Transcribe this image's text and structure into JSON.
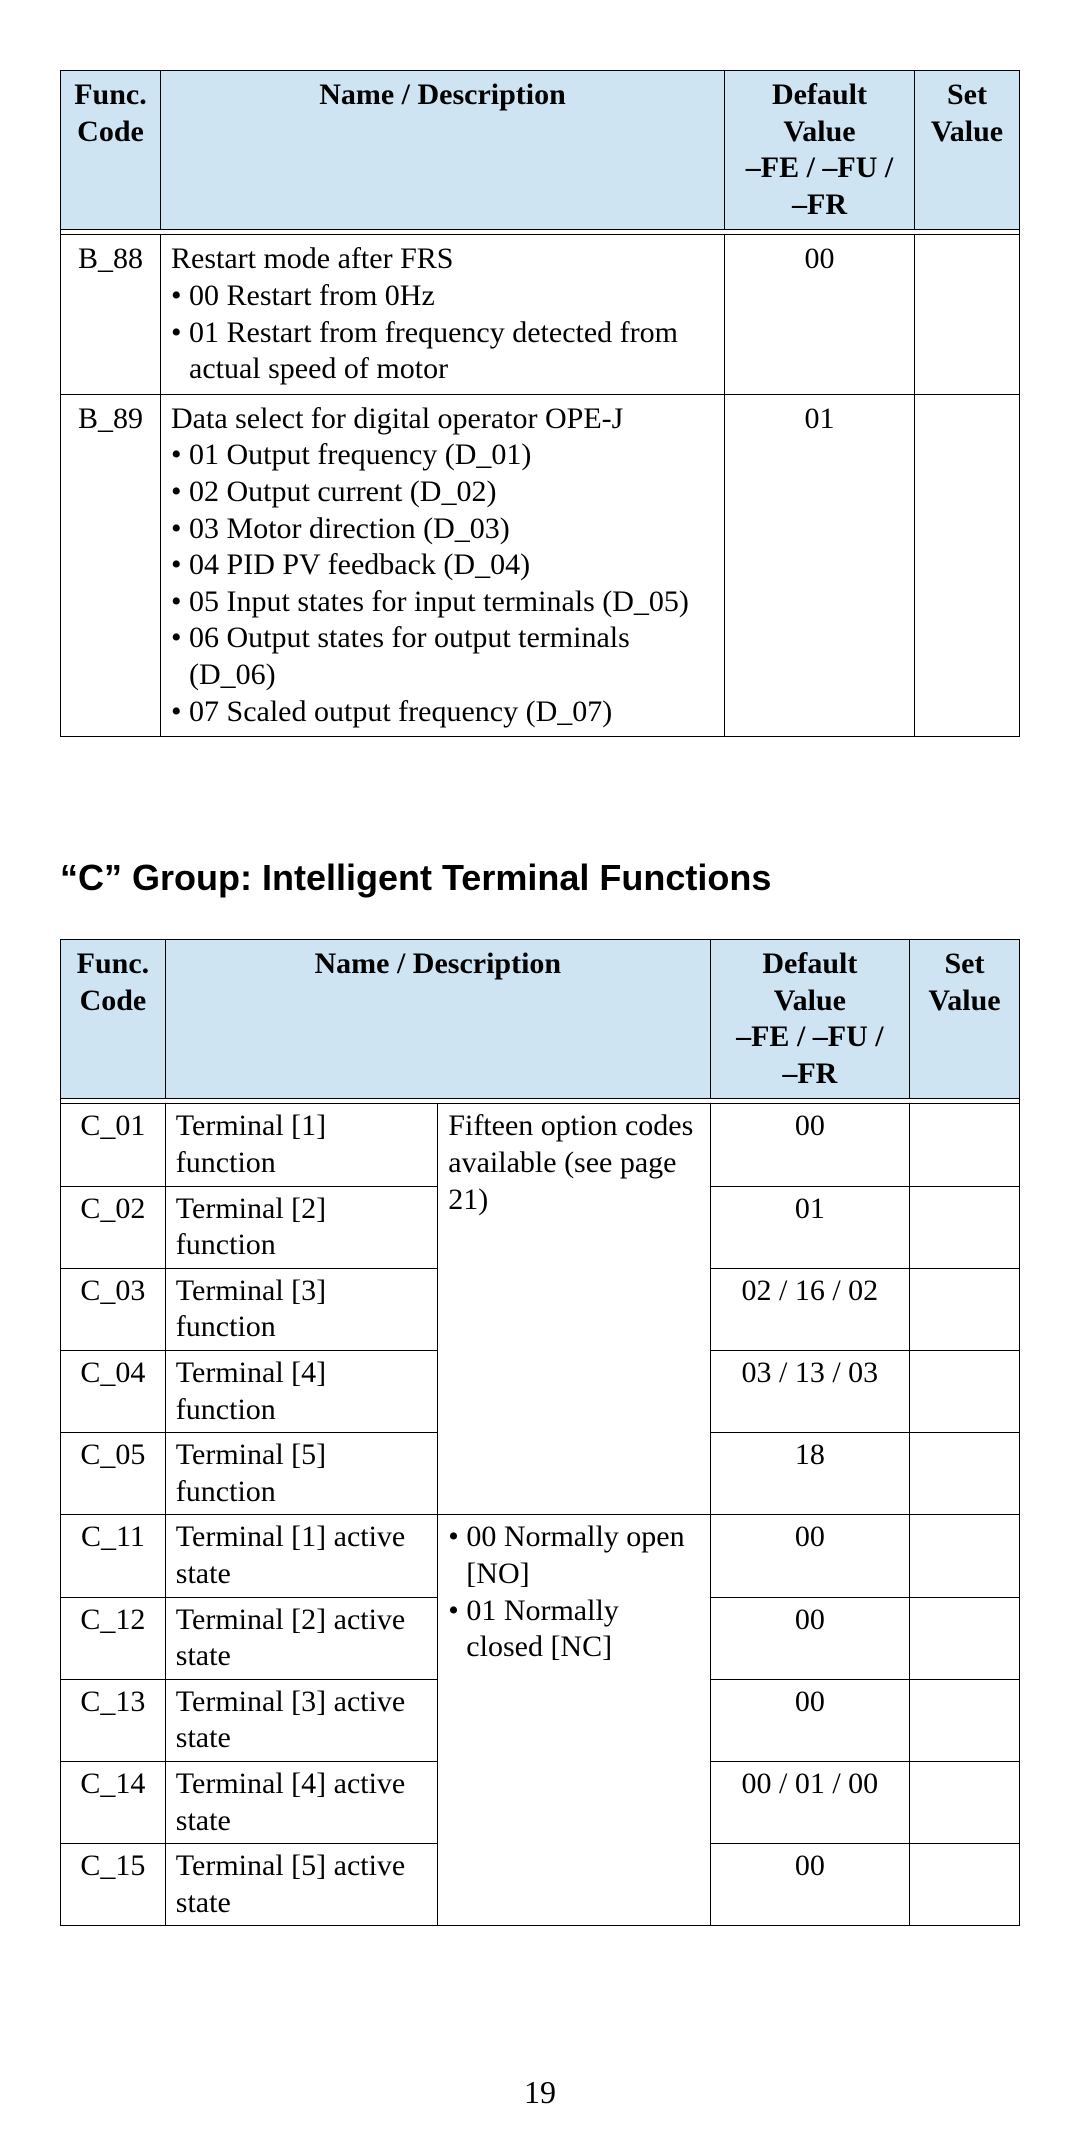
{
  "page_number": "19",
  "headers": {
    "func_code": "Func. Code",
    "name_desc": "Name / Description",
    "default": "Default Value –FE / –FU / –FR",
    "set_value": "Set Value"
  },
  "table1": {
    "rows": [
      {
        "code": "B_88",
        "name": "Restart mode after FRS",
        "bullets": [
          "00 Restart from 0Hz",
          "01 Restart from frequency detected from actual speed of motor"
        ],
        "default": "00",
        "set": ""
      },
      {
        "code": "B_89",
        "name": "Data select for digital operator OPE-J",
        "bullets": [
          "01 Output frequency (D_01)",
          "02 Output current (D_02)",
          "03 Motor direction (D_03)",
          "04 PID PV feedback (D_04)",
          "05 Input states for input terminals (D_05)",
          "06 Output states for output terminals (D_06)",
          "07 Scaled output frequency (D_07)"
        ],
        "default": "01",
        "set": ""
      }
    ]
  },
  "section_title": "“C” Group: Intelligent Terminal Functions",
  "table2": {
    "shared_desc_a": "Fifteen option codes available (see page 21)",
    "shared_desc_b_bullets": [
      "00 Normally open [NO]",
      "01 Normally closed [NC]"
    ],
    "rows_a": [
      {
        "code": "C_01",
        "name": "Terminal [1] function",
        "default": "00",
        "set": ""
      },
      {
        "code": "C_02",
        "name": "Terminal [2] function",
        "default": "01",
        "set": ""
      },
      {
        "code": "C_03",
        "name": "Terminal [3] function",
        "default": "02 / 16 / 02",
        "set": ""
      },
      {
        "code": "C_04",
        "name": "Terminal [4] function",
        "default": "03 / 13 / 03",
        "set": ""
      },
      {
        "code": "C_05",
        "name": "Terminal [5] function",
        "default": "18",
        "set": ""
      }
    ],
    "rows_b": [
      {
        "code": "C_11",
        "name": "Terminal [1] active state",
        "default": "00",
        "set": ""
      },
      {
        "code": "C_12",
        "name": "Terminal [2] active state",
        "default": "00",
        "set": ""
      },
      {
        "code": "C_13",
        "name": "Terminal [3] active state",
        "default": "00",
        "set": ""
      },
      {
        "code": "C_14",
        "name": "Terminal [4] active state",
        "default": "00 / 01 / 00",
        "set": ""
      },
      {
        "code": "C_15",
        "name": "Terminal [5] active state",
        "default": "00",
        "set": ""
      }
    ]
  }
}
